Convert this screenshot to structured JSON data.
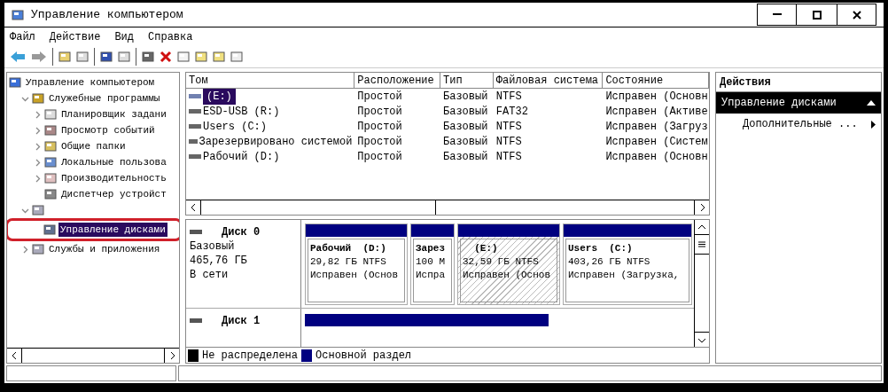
{
  "window": {
    "title": "Управление компьютером"
  },
  "menu": [
    "Файл",
    "Действие",
    "Вид",
    "Справка"
  ],
  "tree": [
    {
      "label": "Управление компьютером",
      "selected": false,
      "children": [
        {
          "label": "Служебные программы",
          "expanded": true,
          "selected": false,
          "children": [
            {
              "label": "Планировщик задани",
              "expanded": false,
              "selected": false
            },
            {
              "label": "Просмотр событий",
              "expanded": false,
              "selected": false
            },
            {
              "label": "Общие папки",
              "expanded": false,
              "selected": false
            },
            {
              "label": "Локальные пользова",
              "expanded": false,
              "selected": false
            },
            {
              "label": "Производительность",
              "expanded": false,
              "selected": false
            },
            {
              "label": "Диспетчер устройст",
              "selected": false
            }
          ]
        },
        {
          "expanded": true,
          "children": [
            {
              "label": "Управление дисками",
              "selected": true,
              "highlighted": true
            }
          ]
        },
        {
          "label": "Службы и приложения",
          "expanded": false,
          "selected": false
        }
      ]
    }
  ],
  "table": {
    "columns": [
      "Том",
      "Расположение",
      "Тип",
      "Файловая система",
      "Состояние"
    ],
    "rows": [
      {
        "selected": true,
        "cells": [
          "(E:)",
          "Простой",
          "Базовый",
          "NTFS",
          "Исправен (Основн"
        ]
      },
      {
        "selected": false,
        "cells": [
          "ESD-USB (R:)",
          "Простой",
          "Базовый",
          "FAT32",
          "Исправен (Активе"
        ]
      },
      {
        "selected": false,
        "cells": [
          "Users (C:)",
          "Простой",
          "Базовый",
          "NTFS",
          "Исправен (Загруз"
        ]
      },
      {
        "selected": false,
        "cells": [
          "Зарезервировано системой",
          "Простой",
          "Базовый",
          "NTFS",
          "Исправен (Систем"
        ]
      },
      {
        "selected": false,
        "cells": [
          "Рабочий (D:)",
          "Простой",
          "Базовый",
          "NTFS",
          "Исправен (Основн"
        ]
      }
    ]
  },
  "disks": [
    {
      "name": "Диск 0",
      "lines": [
        "Базовый",
        "465,76 ГБ",
        "В сети"
      ],
      "partitions": [
        {
          "name": "Рабочий  (D:)",
          "size": "29,82 ГБ NTFS",
          "status": "Исправен (Основ",
          "selected": false
        },
        {
          "name": "Зарез",
          "size": "100 М",
          "status": "Испра",
          "selected": false
        },
        {
          "name": "  (E:)",
          "size": "32,59 ГБ NTFS",
          "status": "Исправен (Основ",
          "selected": true
        },
        {
          "name": "Users  (C:)",
          "size": "403,26 ГБ NTFS",
          "status": "Исправен (Загрузка,",
          "selected": false
        }
      ]
    },
    {
      "name": "Диск 1"
    }
  ],
  "legend": [
    {
      "label": "Не распределена",
      "color": "#000000"
    },
    {
      "label": "Основной раздел",
      "color": "#000080"
    }
  ],
  "actions": {
    "title": "Действия",
    "section": "Управление дисками",
    "items": [
      "Дополнительные ..."
    ]
  }
}
